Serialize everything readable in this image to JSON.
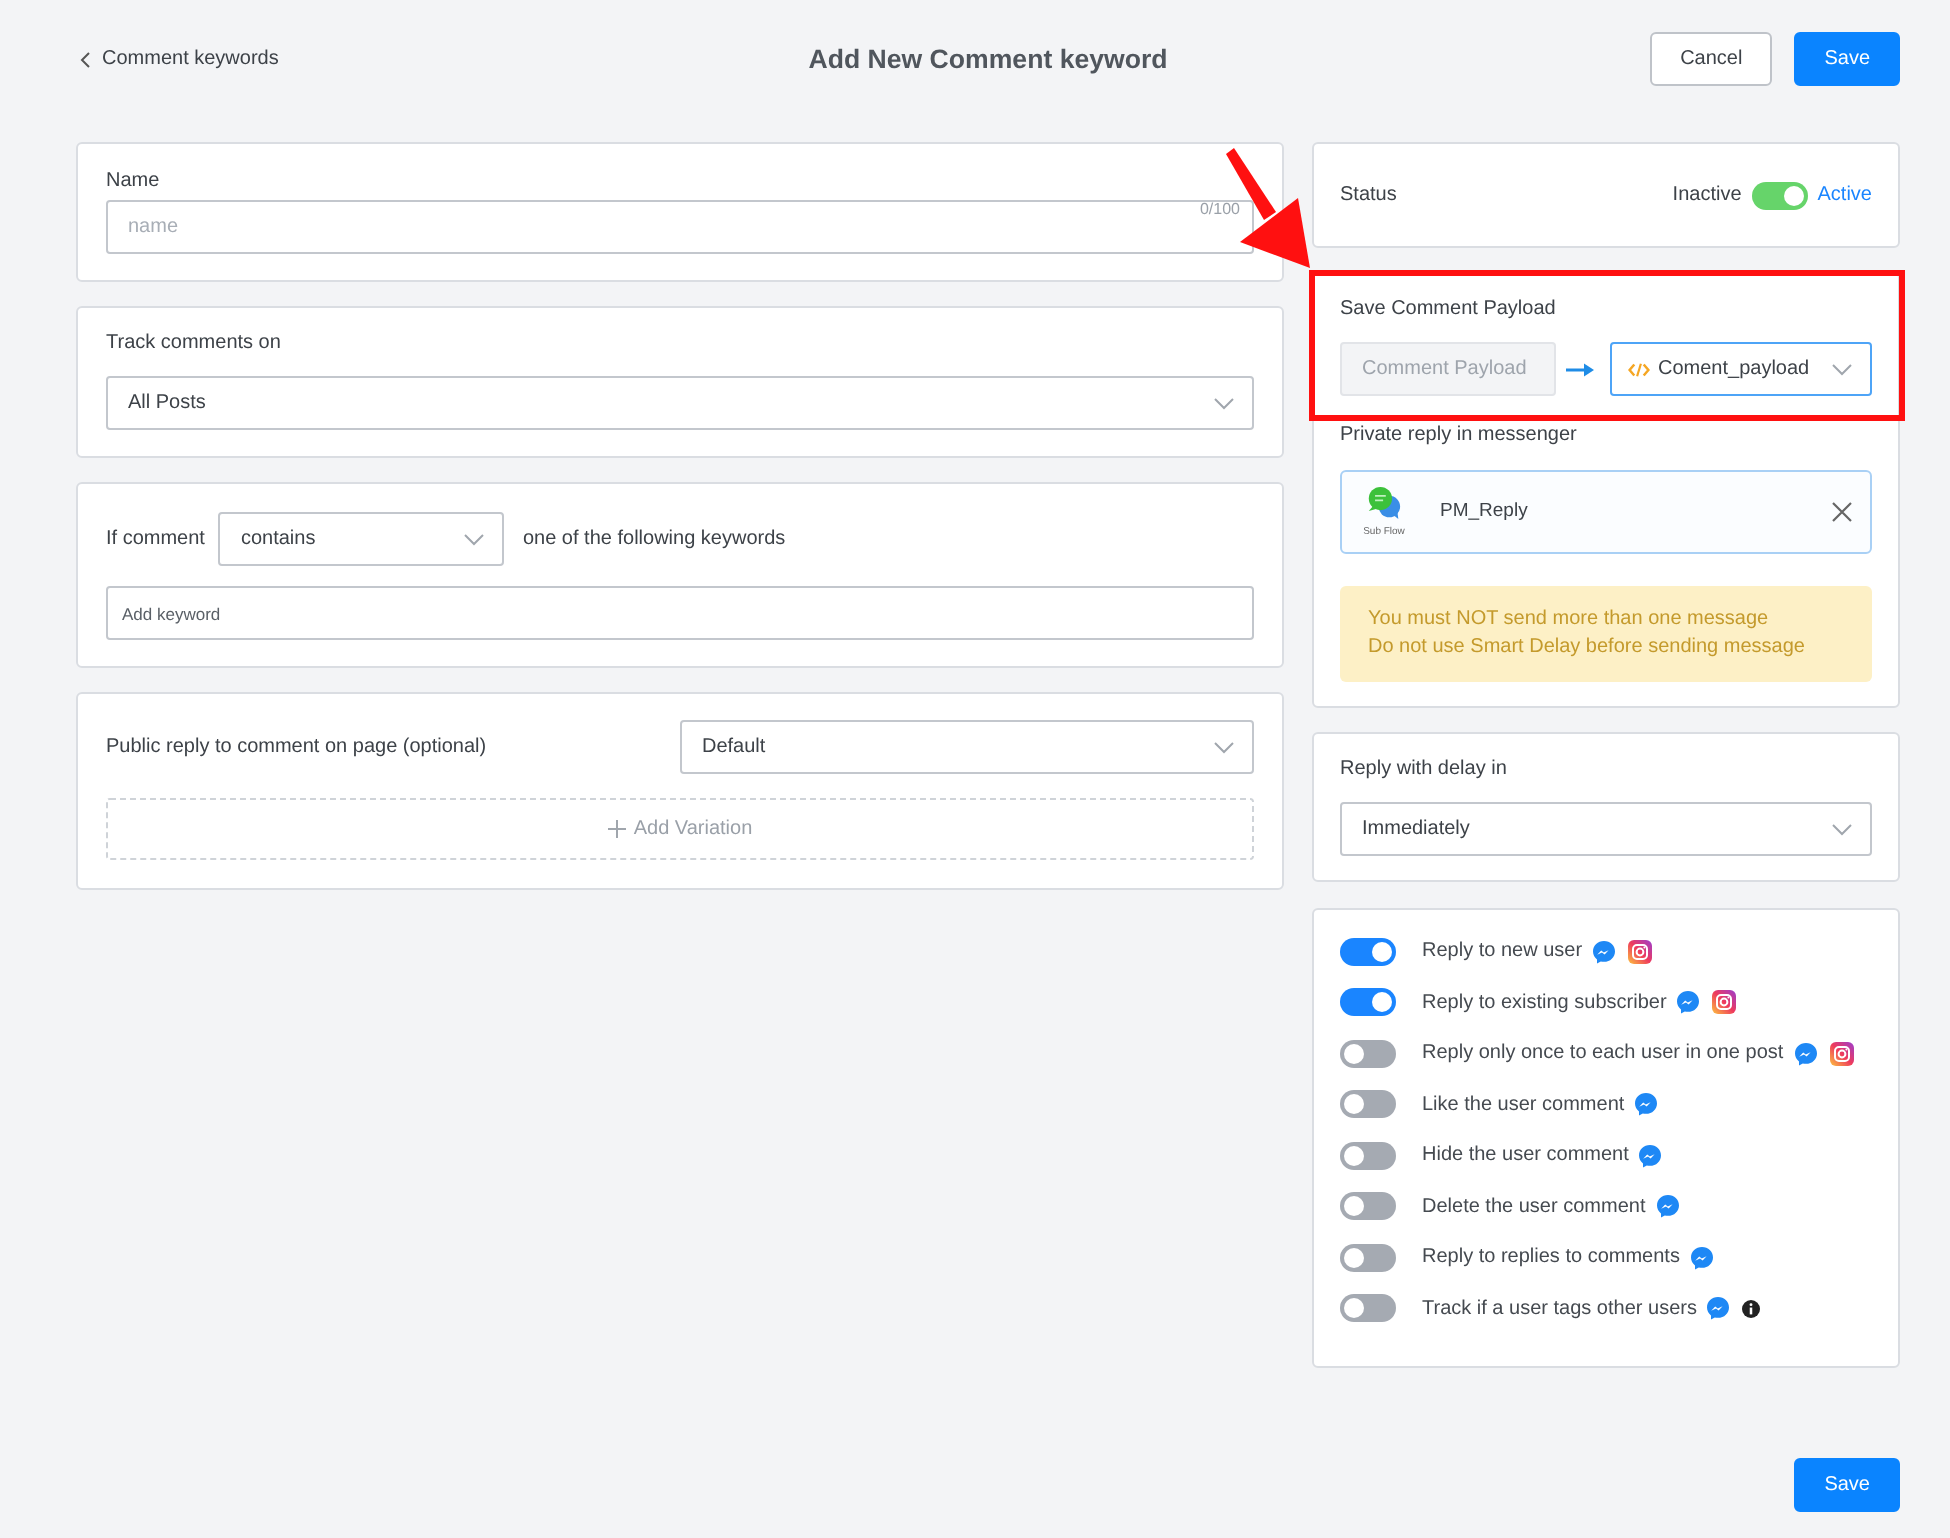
{
  "header": {
    "back_link": "Comment keywords",
    "title": "Add New Comment keyword",
    "buttons": [
      {
        "label": "Cancel",
        "kind": "secondary"
      },
      {
        "label": "Save",
        "kind": "primary"
      }
    ]
  },
  "name_card": {
    "label": "Name",
    "placeholder": "name",
    "counter": "0/100"
  },
  "track_card": {
    "label": "Track comments on",
    "value": "All Posts"
  },
  "condition_card": {
    "prefix": "If comment",
    "operator": "contains",
    "suffix": "one of the following keywords",
    "keyword_field": {
      "placeholder": "Add keyword"
    }
  },
  "public_reply_card": {
    "label": "Public reply to comment on page (optional)",
    "value": "Default",
    "add_button": "Add Variation"
  },
  "status_card": {
    "label": "Status",
    "off_label": "Inactive",
    "on_label": "Active",
    "on": true
  },
  "payload_card": {
    "label": "Save Comment Payload",
    "source": {
      "value": "Comment Payload",
      "disabled": true
    },
    "target": "Coment_payload",
    "private_reply_label": "Private reply in messenger",
    "flow": {
      "caption": "Sub Flow",
      "name": "PM_Reply"
    },
    "warnings": [
      "You must NOT send more than one message",
      "Do not use Smart Delay before sending message"
    ]
  },
  "delay_card": {
    "label": "Reply with delay in",
    "value": "Immediately"
  },
  "options": [
    {
      "label": "Reply to new user",
      "on": true,
      "badges": [
        {
          "kind": "chat"
        },
        {
          "kind": "camera"
        }
      ]
    },
    {
      "label": "Reply to existing subscriber",
      "on": true,
      "badges": [
        {
          "kind": "chat"
        },
        {
          "kind": "camera"
        }
      ]
    },
    {
      "label": "Reply only once to each user in one post",
      "on": false,
      "badges": [
        {
          "kind": "chat"
        },
        {
          "kind": "camera"
        }
      ]
    },
    {
      "label": "Like the user comment",
      "on": false,
      "badges": [
        {
          "kind": "chat"
        }
      ]
    },
    {
      "label": "Hide the user comment",
      "on": false,
      "badges": [
        {
          "kind": "chat"
        }
      ]
    },
    {
      "label": "Delete the user comment",
      "on": false,
      "badges": [
        {
          "kind": "chat"
        }
      ]
    },
    {
      "label": "Reply to replies to comments",
      "on": false,
      "badges": [
        {
          "kind": "chat"
        }
      ]
    },
    {
      "label": "Track if a user tags other users",
      "on": false,
      "badges": [
        {
          "kind": "chat"
        },
        {
          "kind": "info"
        }
      ]
    }
  ],
  "footer": {
    "save_button": "Save"
  }
}
